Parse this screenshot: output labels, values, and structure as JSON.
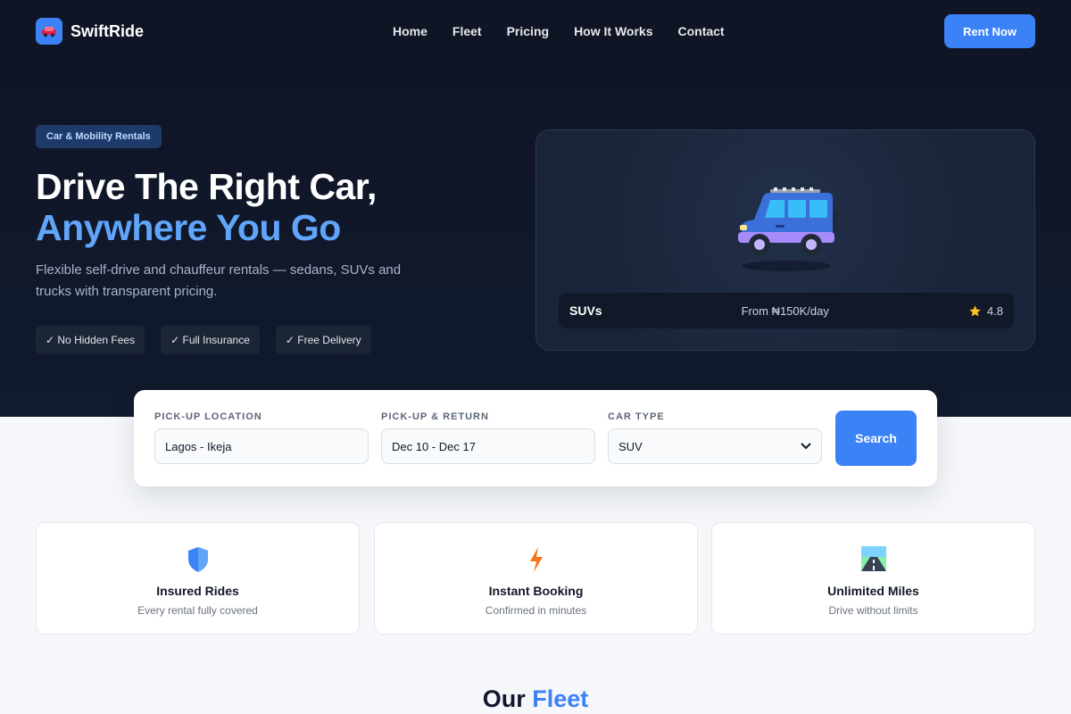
{
  "brand": {
    "name": "SwiftRide",
    "logo_icon": "car-icon",
    "accent": "#3b82f6"
  },
  "nav": {
    "links": [
      "Home",
      "Fleet",
      "Pricing",
      "How It Works",
      "Contact"
    ],
    "cta": "Rent Now"
  },
  "hero": {
    "tag": "Car & Mobility Rentals",
    "headline_line1": "Drive The Right Car,",
    "headline_line2": "Anywhere You Go",
    "subtitle": "Flexible self-drive and chauffeur rentals — sedans, SUVs and trucks with transparent pricing.",
    "chips": [
      "✓ No Hidden Fees",
      "✓ Full Insurance",
      "✓ Free Delivery"
    ]
  },
  "featured_car": {
    "name": "SUVs",
    "price": "From ₦150K/day",
    "rating": "4.8",
    "icon": "suv-icon"
  },
  "search": {
    "pickup_label": "Pick-up Location",
    "pickup_value": "Lagos - Ikeja",
    "dates_label": "Pick-up & Return",
    "dates_value": "Dec 10 - Dec 17",
    "type_label": "Car Type",
    "type_value": "SUV",
    "button": "Search"
  },
  "features": [
    {
      "title": "Insured Rides",
      "desc": "Every rental fully covered",
      "icon": "shield-icon"
    },
    {
      "title": "Instant Booking",
      "desc": "Confirmed in minutes",
      "icon": "lightning-icon"
    },
    {
      "title": "Unlimited Miles",
      "desc": "Drive without limits",
      "icon": "road-icon"
    }
  ],
  "fleet_section": {
    "title_part1": "Our",
    "title_part2": "Fleet"
  }
}
